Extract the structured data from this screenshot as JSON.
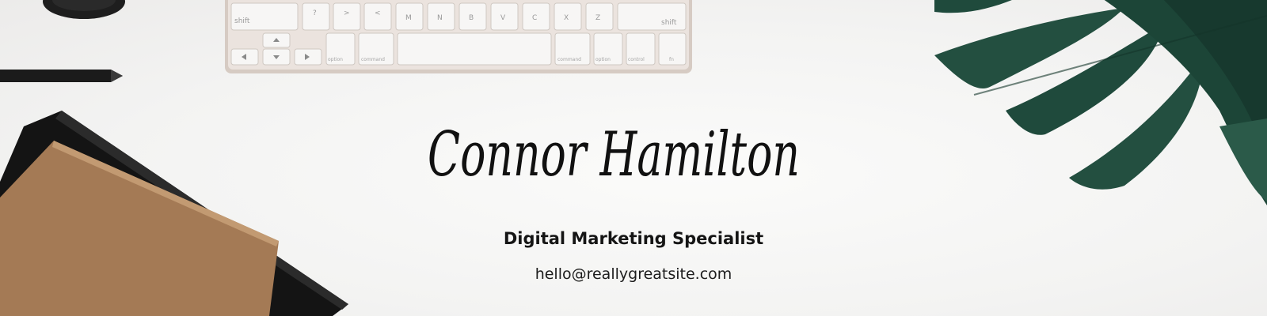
{
  "profile": {
    "name": "Connor Hamilton",
    "title": "Digital Marketing Specialist",
    "email": "hello@reallygreatsite.com"
  },
  "keyboard": {
    "top_row": [
      "shift",
      "?\n/",
      ">\n.",
      "<\n,",
      "M",
      "N",
      "B",
      "V",
      "C",
      "X",
      "Z",
      "shift"
    ],
    "bottom_row": [
      "option",
      "command",
      "command",
      "option",
      "control",
      "fn"
    ]
  },
  "colors": {
    "background": "#f4f3f2",
    "text": "#151515",
    "leaf": "#1f4a3c",
    "notebook": "#a47a55",
    "keyboard": "#d6cbc3"
  },
  "icons": [
    "leaf-icon",
    "notebook-icon",
    "pencil-icon",
    "keyboard-icon",
    "object-icon"
  ]
}
